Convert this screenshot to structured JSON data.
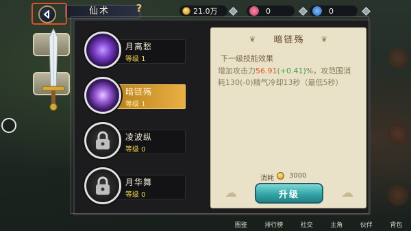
{
  "header": {
    "title": "仙术",
    "help_glyph": "?",
    "gold": "21.0万",
    "currency_pink": "0",
    "currency_blue": "0"
  },
  "skills": [
    {
      "name": "月离愁",
      "level": "等级 1",
      "icon": "moon-swirl-icon",
      "locked": false
    },
    {
      "name": "暗链殇",
      "level": "等级 1",
      "icon": "dark-chain-icon",
      "locked": false,
      "selected": true
    },
    {
      "name": "凌波纵",
      "level": "等级 0",
      "icon": "padlock-icon",
      "locked": true
    },
    {
      "name": "月华舞",
      "level": "等级 0",
      "icon": "padlock-icon",
      "locked": true
    }
  ],
  "detail": {
    "title": "暗链殇",
    "subtitle": "下一级技能效果",
    "desc_part1": "增加攻击力",
    "desc_value": "56.91",
    "desc_delta": "(+0.41)",
    "desc_part2": "%，攻范围消耗130",
    "desc_part3": "(-0)",
    "desc_part4": "精气冷却13秒（最低5秒）",
    "cost_label": "消耗",
    "cost_value": "3000",
    "upgrade_label": "升级"
  },
  "bottom_nav": [
    "图鉴",
    "排行榜",
    "社交",
    "主角",
    "伙伴",
    "背包"
  ],
  "colors": {
    "accent_gold": "#eab043",
    "upgrade_teal": "#35a5a7",
    "highlight_red": "#d8562a",
    "delta_green": "#38a43a"
  }
}
